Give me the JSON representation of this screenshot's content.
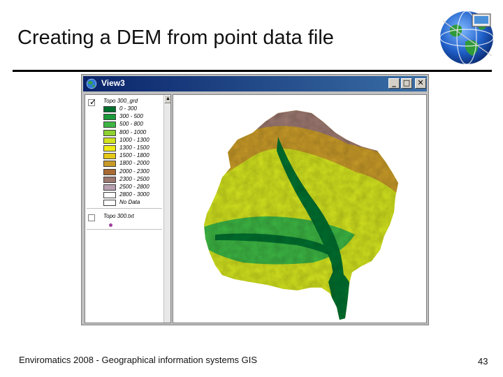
{
  "slide": {
    "title": "Creating a DEM from point data file",
    "footer": "Enviromatics 2008 - Geographical information systems GIS",
    "page_number": "43"
  },
  "window": {
    "title": "View3",
    "icon": "globe-icon",
    "buttons": {
      "minimize": "_",
      "restore": "□",
      "close": "✕"
    }
  },
  "toc": {
    "raster_layer": {
      "name": "Topo 300_grd",
      "checked": true,
      "legend": [
        {
          "label": "0 - 300",
          "color": "#006f2e"
        },
        {
          "label": "300 - 500",
          "color": "#1a9a3a"
        },
        {
          "label": "500 - 800",
          "color": "#3cb543"
        },
        {
          "label": "800 - 1000",
          "color": "#8fd130"
        },
        {
          "label": "1000 - 1300",
          "color": "#d2e21e"
        },
        {
          "label": "1300 - 1500",
          "color": "#f0ec14"
        },
        {
          "label": "1500 - 1800",
          "color": "#e6c818"
        },
        {
          "label": "1800 - 2000",
          "color": "#c89a28"
        },
        {
          "label": "2000 - 2300",
          "color": "#a86a32"
        },
        {
          "label": "2300 - 2500",
          "color": "#9c7870"
        },
        {
          "label": "2500 - 2800",
          "color": "#b8a0b0"
        },
        {
          "label": "2800 - 3000",
          "color": "#ffffff"
        },
        {
          "label": "No Data",
          "color": "#ffffff"
        }
      ]
    },
    "point_layer": {
      "name": "Topo 300.txt",
      "checked": false,
      "symbol_color": "#a040a0"
    }
  },
  "map": {
    "content": "elevation-raster",
    "colors": {
      "low": "#006f2e",
      "low_mid": "#3cb543",
      "mid": "#d2e21e",
      "high": "#c89a28",
      "peak": "#9c7870"
    }
  }
}
